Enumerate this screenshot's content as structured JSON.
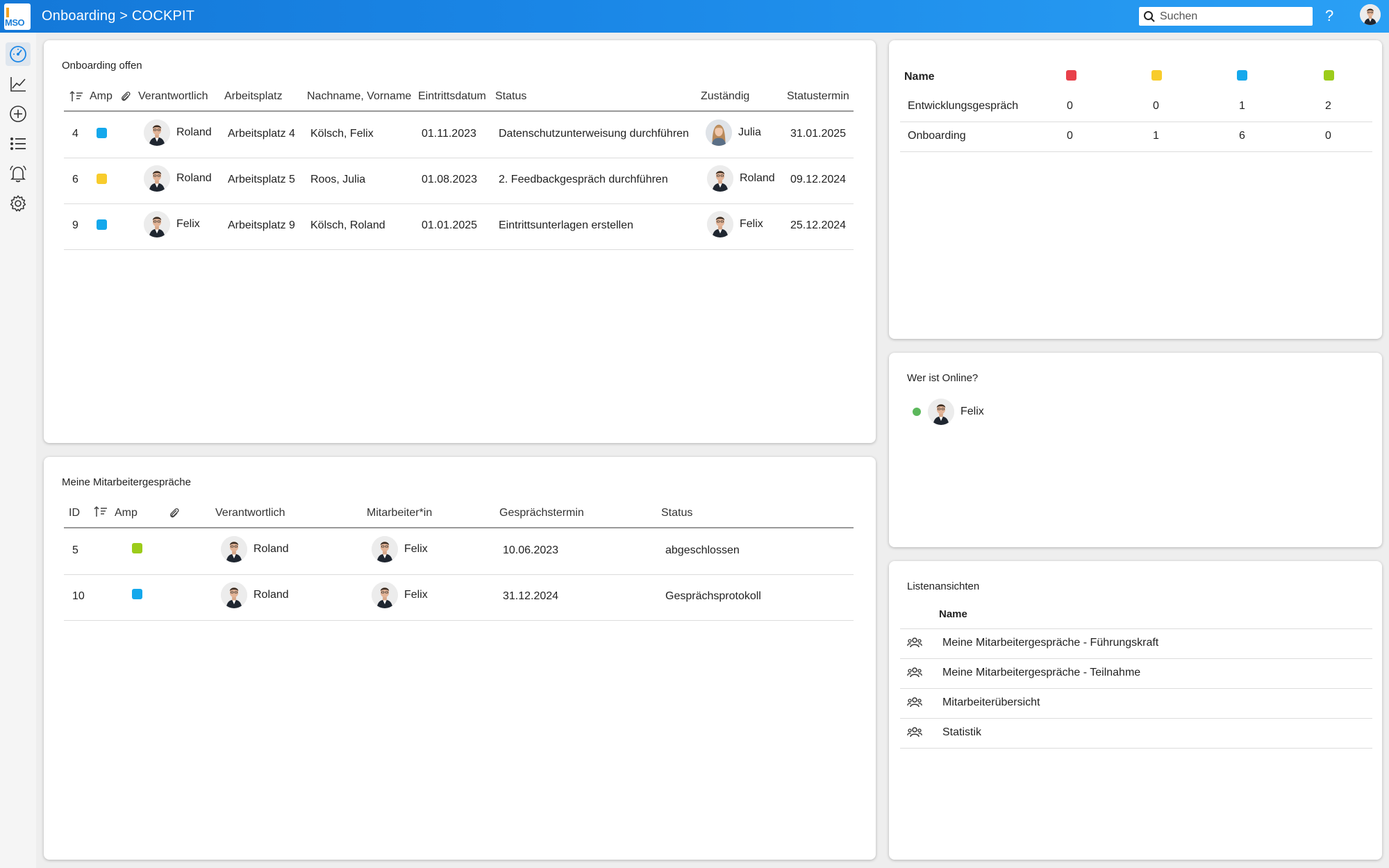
{
  "app": {
    "logo_text": "MSO",
    "title": "Onboarding > COCKPIT",
    "search_placeholder": "Suchen",
    "help_label": "?"
  },
  "sidebar": {
    "items": [
      {
        "icon": "dashboard-icon",
        "active": true
      },
      {
        "icon": "chart-icon"
      },
      {
        "icon": "add-circle-icon"
      },
      {
        "icon": "list-icon"
      },
      {
        "icon": "bell-icon"
      },
      {
        "icon": "gear-icon"
      }
    ]
  },
  "colors": {
    "red": "#e8404a",
    "yellow": "#f8cc2c",
    "blue": "#14a8ec",
    "green": "#9ccc1a",
    "online": "#5cb85c"
  },
  "onboarding": {
    "title": "Onboarding offen",
    "headers": {
      "amp": "Amp",
      "verantwortlich": "Verantwortlich",
      "arbeitsplatz": "Arbeitsplatz",
      "name": "Nachname, Vorname",
      "eintritt": "Eintrittsdatum",
      "status": "Status",
      "zustaendig": "Zuständig",
      "statustermin": "Statustermin"
    },
    "rows": [
      {
        "id": "4",
        "amp": "blue",
        "verantwortlich": "Roland",
        "arbeitsplatz": "Arbeitsplatz 4",
        "name": "Kölsch, Felix",
        "eintritt": "01.11.2023",
        "status": "Datenschutzunterweisung durchführen",
        "zustaendig": "Julia",
        "statustermin": "31.01.2025"
      },
      {
        "id": "6",
        "amp": "yellow",
        "verantwortlich": "Roland",
        "arbeitsplatz": "Arbeitsplatz 5",
        "name": "Roos, Julia",
        "eintritt": "01.08.2023",
        "status": "2. Feedbackgespräch durchführen",
        "zustaendig": "Roland",
        "statustermin": "09.12.2024"
      },
      {
        "id": "9",
        "amp": "blue",
        "verantwortlich": "Felix",
        "arbeitsplatz": "Arbeitsplatz 9",
        "name": "Kölsch, Roland",
        "eintritt": "01.01.2025",
        "status": "Eintrittsunterlagen erstellen",
        "zustaendig": "Felix",
        "statustermin": "25.12.2024"
      }
    ]
  },
  "mitarbeitergespraeche": {
    "title": "Meine Mitarbeitergespräche",
    "headers": {
      "id": "ID",
      "amp": "Amp",
      "verantwortlich": "Verantwortlich",
      "mitarbeiter": "Mitarbeiter*in",
      "termin": "Gesprächstermin",
      "status": "Status"
    },
    "rows": [
      {
        "id": "5",
        "amp": "green",
        "verantwortlich": "Roland",
        "mitarbeiter": "Felix",
        "termin": "10.06.2023",
        "status": "abgeschlossen"
      },
      {
        "id": "10",
        "amp": "blue",
        "verantwortlich": "Roland",
        "mitarbeiter": "Felix",
        "termin": "31.12.2024",
        "status": "Gesprächsprotokoll"
      }
    ]
  },
  "stats": {
    "header_name": "Name",
    "rows": [
      {
        "name": "Entwicklungsgespräch",
        "red": "0",
        "yellow": "0",
        "blue": "1",
        "green": "2"
      },
      {
        "name": "Onboarding",
        "red": "0",
        "yellow": "1",
        "blue": "6",
        "green": "0"
      }
    ]
  },
  "online": {
    "title": "Wer ist Online?",
    "users": [
      {
        "name": "Felix"
      }
    ]
  },
  "listviews": {
    "title": "Listenansichten",
    "header_name": "Name",
    "items": [
      {
        "label": "Meine Mitarbeitergespräche - Führungskraft"
      },
      {
        "label": "Meine Mitarbeitergespräche - Teilnahme"
      },
      {
        "label": "Mitarbeiterübersicht"
      },
      {
        "label": "Statistik"
      }
    ]
  }
}
